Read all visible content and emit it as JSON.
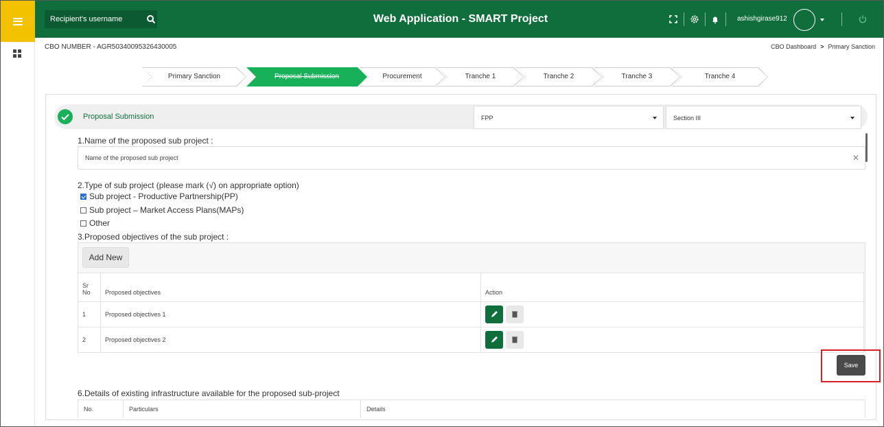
{
  "header": {
    "title": "Web Application - SMART Project",
    "search_placeholder": "Recipient's username",
    "username": "ashishgirase912"
  },
  "page": {
    "cbo_number": "CBO NUMBER - AGR50340095326430005",
    "breadcrumb": [
      "CBO Dashboard",
      "Primary Sanction"
    ],
    "breadcrumb_sep": ">"
  },
  "steps": [
    {
      "label": "Primary Sanction",
      "active": false
    },
    {
      "label": "Proposal Submission",
      "active": true
    },
    {
      "label": "Procurement",
      "active": false
    },
    {
      "label": "Tranche 1",
      "active": false
    },
    {
      "label": "Tranche 2",
      "active": false
    },
    {
      "label": "Tranche 3",
      "active": false
    },
    {
      "label": "Tranche 4",
      "active": false
    }
  ],
  "section": {
    "title": "Proposal Submission",
    "select_1": "FPP",
    "select_2": "Section III"
  },
  "q1": {
    "label": "1.Name of the proposed sub project :",
    "placeholder": "Name of the proposed sub project"
  },
  "q2": {
    "label": "2.Type of sub project (please mark (√) on appropriate option)",
    "options": [
      {
        "label": "Sub project - Productive Partnership(PP)",
        "checked": true
      },
      {
        "label": "Sub project – Market Access Plans(MAPs)",
        "checked": false
      },
      {
        "label": "Other",
        "checked": false
      }
    ]
  },
  "q3": {
    "label": "3.Proposed objectives of the sub project :",
    "add_label": "Add New",
    "columns": [
      "Sr No",
      "Proposed objectives",
      "Action"
    ],
    "rows": [
      {
        "sr": "1",
        "objective": "Proposed objectives 1"
      },
      {
        "sr": "2",
        "objective": "Proposed objectives 2"
      }
    ]
  },
  "save_label": "Save",
  "q6": {
    "label": "6.Details of existing infrastructure available for the proposed sub-project",
    "columns": [
      "No.",
      "Particulars",
      "Details"
    ]
  },
  "colors": {
    "primary": "#0f6e3c",
    "active_step": "#19b05a",
    "rail_top": "#f2c200",
    "highlight": "#d92020"
  }
}
